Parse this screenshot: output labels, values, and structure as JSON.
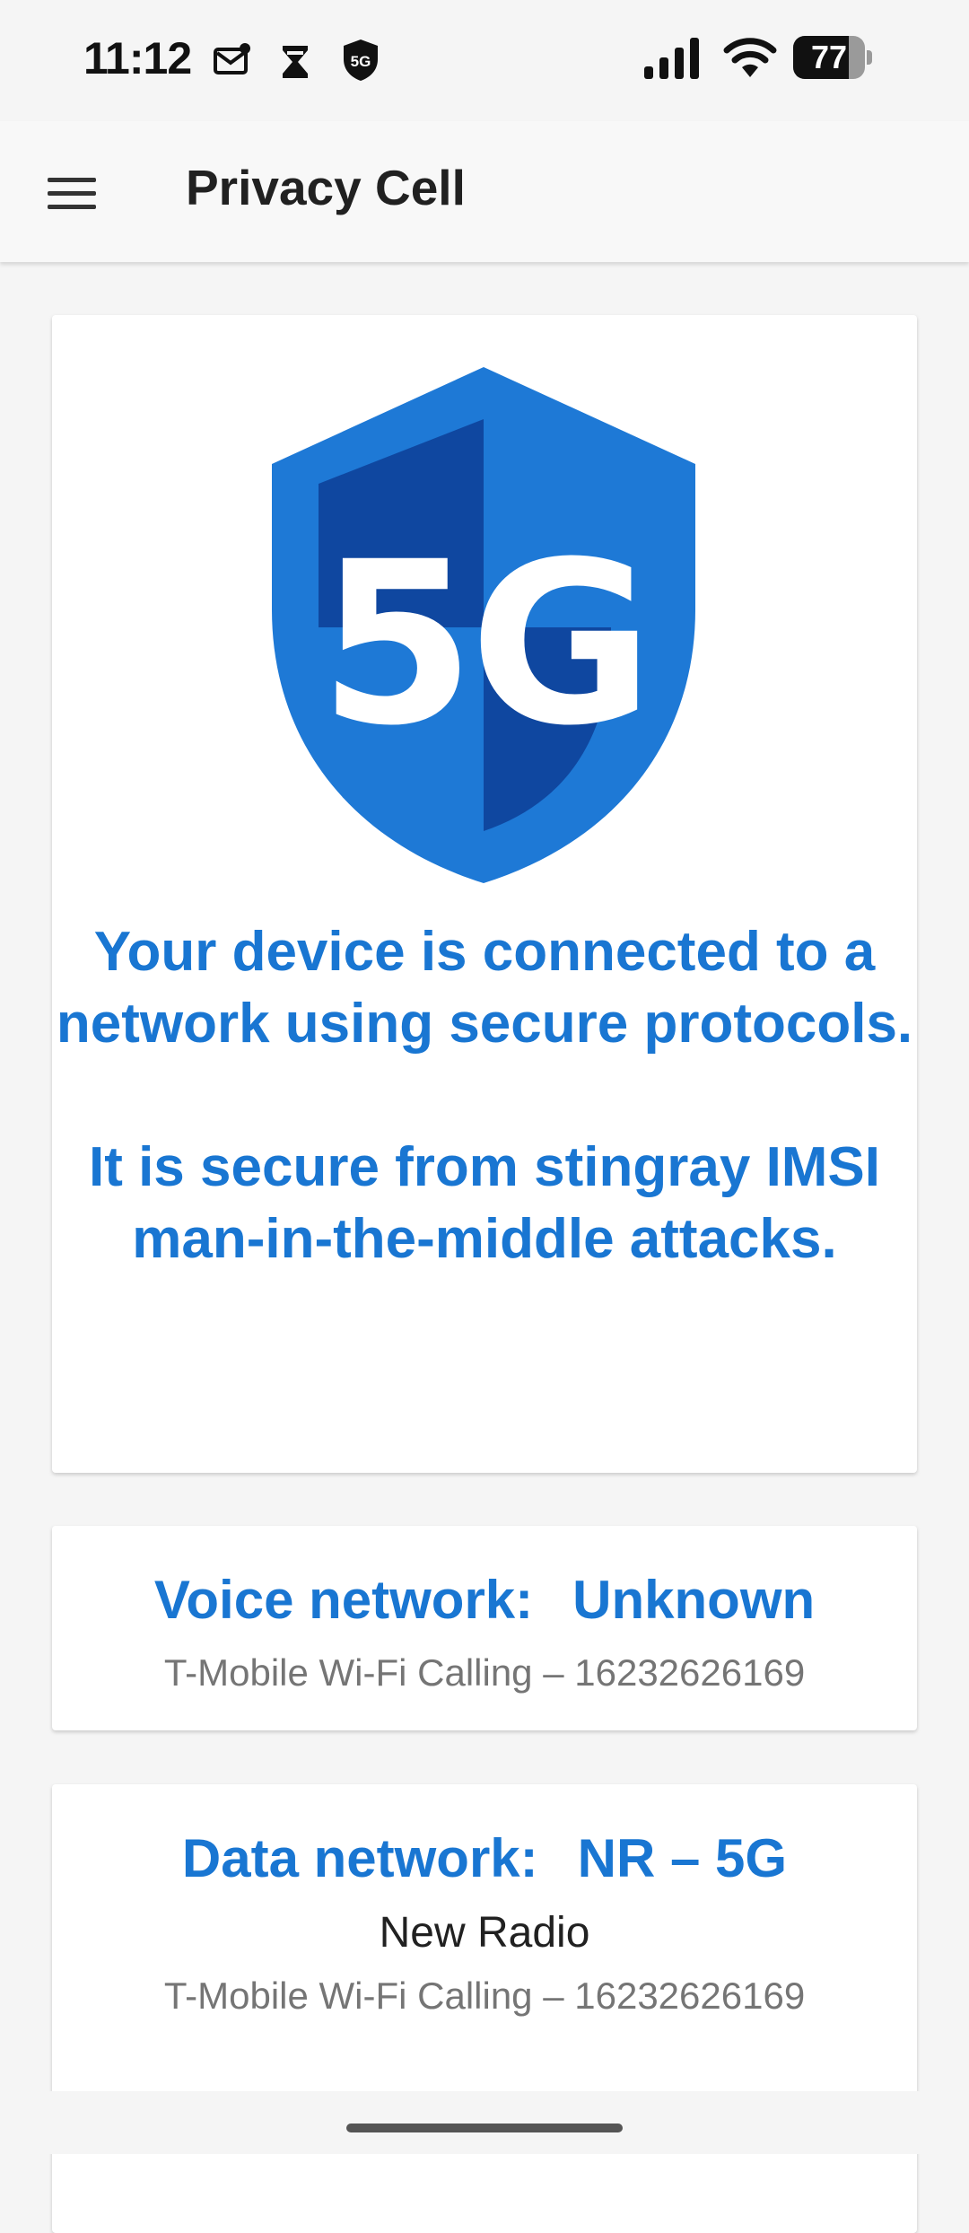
{
  "status_bar": {
    "time": "11:12",
    "battery_level": "77",
    "battery_fraction": 0.77,
    "left_icons": [
      "mail-icon",
      "hourglass-icon",
      "5g-shield-icon"
    ],
    "right_icons": [
      "cellular-signal-icon",
      "wifi-icon",
      "battery-icon"
    ]
  },
  "app_bar": {
    "title": "Privacy Cell",
    "menu_icon": "hamburger-menu-icon"
  },
  "security_card": {
    "shield_icon": "5g-shield-icon",
    "shield_label": "5G",
    "message_line1": "Your device is connected to a network using secure protocols.",
    "message_line2": "It is secure from stingray IMSI man-in-the-middle attacks.",
    "colors": {
      "primary": "#1976d2",
      "shield_light": "#1e79d6",
      "shield_dark": "#0f47a0"
    }
  },
  "voice_card": {
    "label": "Voice network:",
    "value": "Unknown",
    "subtitle": "T-Mobile Wi-Fi Calling – 16232626169"
  },
  "data_card": {
    "label": "Data network:",
    "value": "NR – 5G",
    "network_type": "New Radio",
    "subtitle": "T-Mobile Wi-Fi Calling – 16232626169"
  }
}
